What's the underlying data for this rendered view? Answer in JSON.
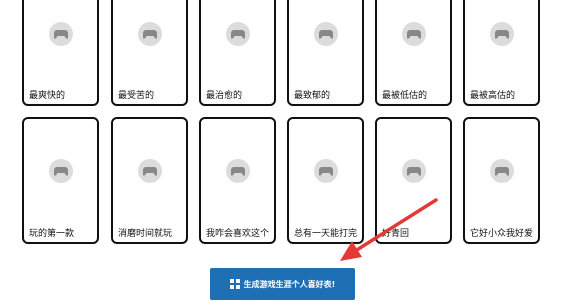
{
  "grid": {
    "row1": [
      {
        "label": "最爽快的",
        "icon": "gamepad-icon"
      },
      {
        "label": "最受苦的",
        "icon": "gamepad-icon"
      },
      {
        "label": "最治愈的",
        "icon": "gamepad-icon"
      },
      {
        "label": "最致郁的",
        "icon": "gamepad-icon"
      },
      {
        "label": "最被低估的",
        "icon": "gamepad-icon"
      },
      {
        "label": "最被高估的",
        "icon": "gamepad-icon"
      }
    ],
    "row2": [
      {
        "label": "玩的第一款",
        "icon": "gamepad-icon"
      },
      {
        "label": "消磨时间就玩",
        "icon": "gamepad-icon"
      },
      {
        "label": "我咋会喜欢这个",
        "icon": "gamepad-icon"
      },
      {
        "label": "总有一天能打完",
        "icon": "gamepad-icon"
      },
      {
        "label": "好青回",
        "icon": "gamepad-icon"
      },
      {
        "label": "它好小众我好爱",
        "icon": "gamepad-icon"
      }
    ]
  },
  "generate_button": {
    "label": "生成游戏生涯个人喜好表!",
    "icon": "grid-icon"
  },
  "colors": {
    "button": "#1f6fb5",
    "arrow": "#e53935",
    "card_border": "#111111",
    "icon_circle": "#dcdcdc"
  }
}
